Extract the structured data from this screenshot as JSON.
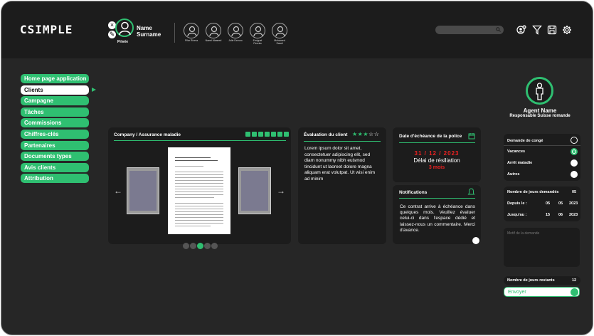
{
  "app": {
    "logo": "CSIMPLE"
  },
  "user": {
    "name_line1": "Name",
    "name_line2": "Surname",
    "status": "Privée"
  },
  "team": [
    {
      "label": "Pilar Rivera"
    },
    {
      "label": "Naeel Maaeed"
    },
    {
      "label": "Julie Devoro"
    },
    {
      "label": "Emiguel Pereira"
    },
    {
      "label": "Mohamed Saadi"
    }
  ],
  "search": {
    "placeholder": ""
  },
  "toolbar_icons": [
    "add-user-icon",
    "filter-icon",
    "save-icon",
    "settings-icon"
  ],
  "menu": {
    "items": [
      {
        "label": "Home page application",
        "active": false
      },
      {
        "label": "Clients",
        "active": true
      },
      {
        "label": "Campagne",
        "active": false
      },
      {
        "label": "Tâches",
        "active": false
      },
      {
        "label": "Commissions",
        "active": false
      },
      {
        "label": "Chiffres-clés",
        "active": false
      },
      {
        "label": "Partenaires",
        "active": false
      },
      {
        "label": "Documents types",
        "active": false
      },
      {
        "label": "Avis clients",
        "active": false
      },
      {
        "label": "Attribution",
        "active": false
      }
    ]
  },
  "document": {
    "breadcrumb": "Company  /   Assurance maladie",
    "carousel_pages": 5,
    "carousel_current": 3
  },
  "evaluation": {
    "title": "Évaluation du client",
    "rating": 3,
    "max_rating": 5,
    "text": "Lorem ipsum dolor sit amet, consectetuer adipiscing elit, sed diam nonummy nibh euismod tincidunt ut laoreet dolore magna aliquam erat volutpat. Ut wisi enim ad minim"
  },
  "policy": {
    "title": "Date d'échéance de la police",
    "date": "31  /  12  /  2023",
    "notice_label": "Délai de résiliation",
    "notice_value": "3 mois"
  },
  "notifications": {
    "title": "Notifications",
    "text": "Ce contrat arrive à échéance dans quelques mois. Veuillez évaluer celui-ci dans l'espace dédié et laissez-nous un commentaire. Merci d'avance."
  },
  "agent": {
    "name": "Agent Name",
    "role": "Responsable Suisse romande"
  },
  "leave": {
    "title": "Demande de congé",
    "options": [
      {
        "label": "Vacances",
        "selected": true
      },
      {
        "label": "Arrêt maladie",
        "selected": false
      },
      {
        "label": "Autres",
        "selected": false
      }
    ]
  },
  "days": {
    "requested_label": "Nombre de jours demandés",
    "requested_value": "05",
    "from_label": "Depuis le :",
    "from_day": "05",
    "from_month": "05",
    "from_year": "2023",
    "to_label": "Jusqu'au :",
    "to_day": "15",
    "to_month": "06",
    "to_year": "2023"
  },
  "note": {
    "placeholder": "Motif de la demande"
  },
  "remaining": {
    "label": "Nombre de jours restants",
    "value": "12"
  },
  "send": {
    "label": "Envoyer"
  },
  "colors": {
    "accent": "#2fbf71",
    "alert": "#e22222",
    "background": "#262626",
    "card": "#1c1c1c"
  }
}
